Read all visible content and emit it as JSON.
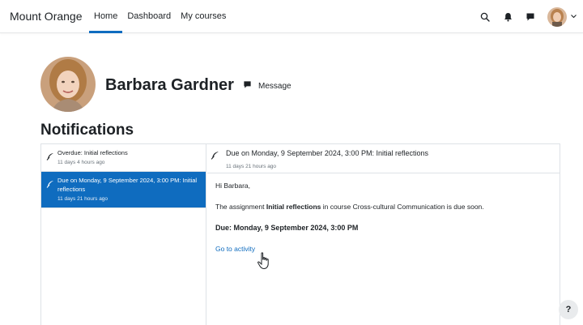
{
  "navbar": {
    "brand": "Mount Orange",
    "links": [
      {
        "label": "Home",
        "active": true
      },
      {
        "label": "Dashboard",
        "active": false
      },
      {
        "label": "My courses",
        "active": false
      }
    ],
    "icons": [
      "search-icon",
      "bell-icon",
      "chat-icon",
      "user-avatar",
      "chevron-down-icon"
    ]
  },
  "profile": {
    "name": "Barbara Gardner",
    "message_label": "Message"
  },
  "page_title": "Notifications",
  "notifications": [
    {
      "title": "Overdue: Initial reflections",
      "time": "11 days 4 hours ago",
      "selected": false,
      "icon": "feather-icon"
    },
    {
      "title": "Due on Monday, 9 September 2024, 3:00 PM: Initial reflections",
      "time": "11 days 21 hours ago",
      "selected": true,
      "icon": "feather-icon"
    }
  ],
  "detail": {
    "title": "Due on Monday, 9 September 2024, 3:00 PM: Initial reflections",
    "time": "11 days 21 hours ago",
    "greeting": "Hi Barbara,",
    "body_prefix": "The assignment ",
    "assignment": "Initial reflections",
    "body_suffix": " in course Cross-cultural Communication is due soon.",
    "due_line": "Due: Monday, 9 September 2024, 3:00 PM",
    "link_label": "Go to activity"
  },
  "help_label": "?",
  "colors": {
    "primary": "#0f6cbf",
    "text": "#1d2125",
    "muted": "#6a737b",
    "border": "#dee2e6"
  }
}
